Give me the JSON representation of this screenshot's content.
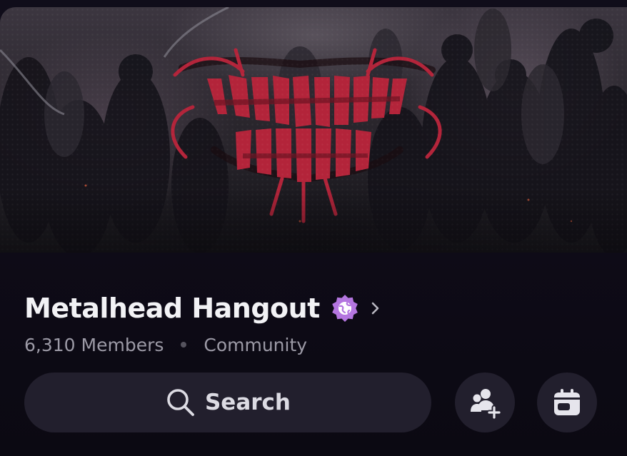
{
  "banner": {
    "logo_text": "Metalhead Hangout"
  },
  "server": {
    "name": "Metalhead Hangout",
    "badge_icon": "discover-globe-badge-icon",
    "badge_color": "#b476e0",
    "chevron_icon": "chevron-right-icon"
  },
  "meta": {
    "members": "6,310 Members",
    "type": "Community"
  },
  "search": {
    "label": "Search",
    "icon": "search-icon"
  },
  "actions": {
    "invite_icon": "add-member-icon",
    "events_icon": "calendar-icon"
  },
  "colors": {
    "background": "#0e0b17",
    "surface": "#221f2d",
    "title_text": "#f2f2f5",
    "meta_text": "#9c9aa6",
    "logo_red": "#b3243a"
  }
}
